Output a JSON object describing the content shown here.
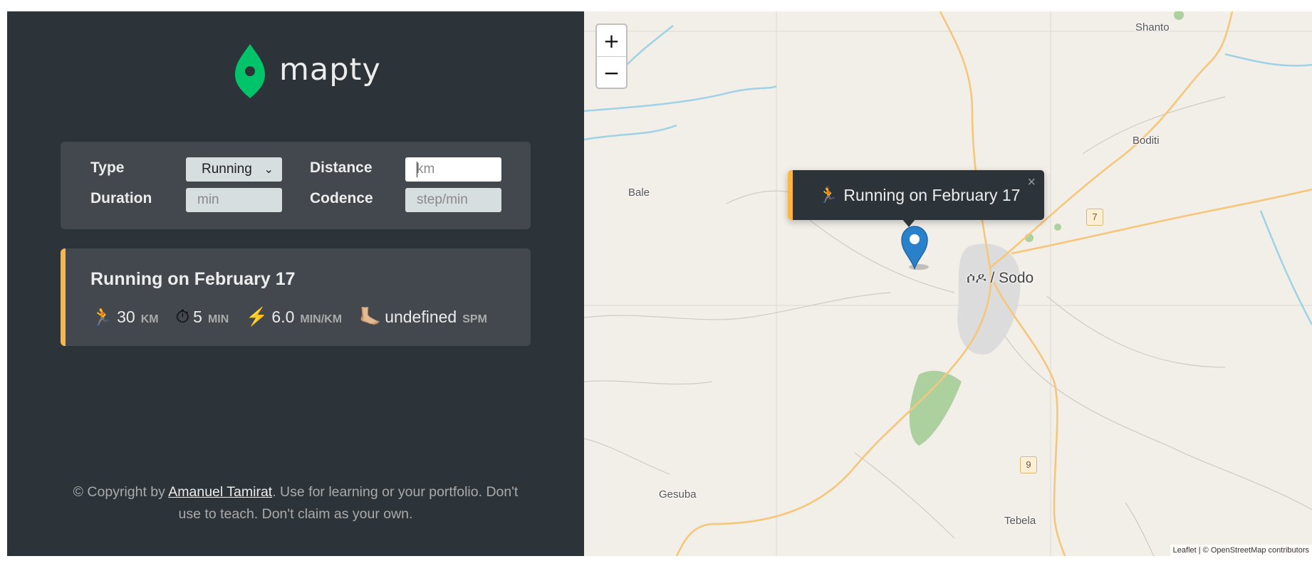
{
  "brand": {
    "name": "mapty",
    "logo_icon": "map-pin-icon"
  },
  "form": {
    "type_label": "Type",
    "type_value": "Running",
    "distance_label": "Distance",
    "distance_placeholder": "km",
    "duration_label": "Duration",
    "duration_placeholder": "min",
    "cadence_label": "Codence",
    "cadence_placeholder": "step/min"
  },
  "workouts": [
    {
      "title": "Running on February 17",
      "accent": "#ffb545",
      "details": [
        {
          "icon": "🏃",
          "value": "30",
          "unit": "km"
        },
        {
          "icon": "⏱",
          "value": "5",
          "unit": "min"
        },
        {
          "icon": "⚡️",
          "value": "6.0",
          "unit": "min/km"
        },
        {
          "icon": "🦶🏼",
          "value": "undefined",
          "unit": "spm"
        }
      ]
    }
  ],
  "footer": {
    "prefix": "© Copyright by ",
    "author": "Amanuel Tamirat",
    "suffix": ". Use for learning or your portfolio. Don't use to teach. Don't claim as your own."
  },
  "map": {
    "zoom_in": "+",
    "zoom_out": "−",
    "popup": {
      "icon": "🏃",
      "text": "Running on February 17",
      "close": "×"
    },
    "towns": {
      "shanto": "Shanto",
      "boditi": "Boditi",
      "bale": "Bale",
      "sodo": "ሶዶ / Sodo",
      "gesuba": "Gesuba",
      "tebela": "Tebela"
    },
    "road_shields": {
      "r7": "7",
      "r9": "9"
    },
    "attribution": "Leaflet | © OpenStreetMap contributors"
  },
  "colors": {
    "sidebar": "#2d3439",
    "panel": "#42484d",
    "brand_green": "#00c46a",
    "running_accent": "#ffb545",
    "map_bg": "#f2efe9",
    "marker_blue": "#2a81cb"
  }
}
